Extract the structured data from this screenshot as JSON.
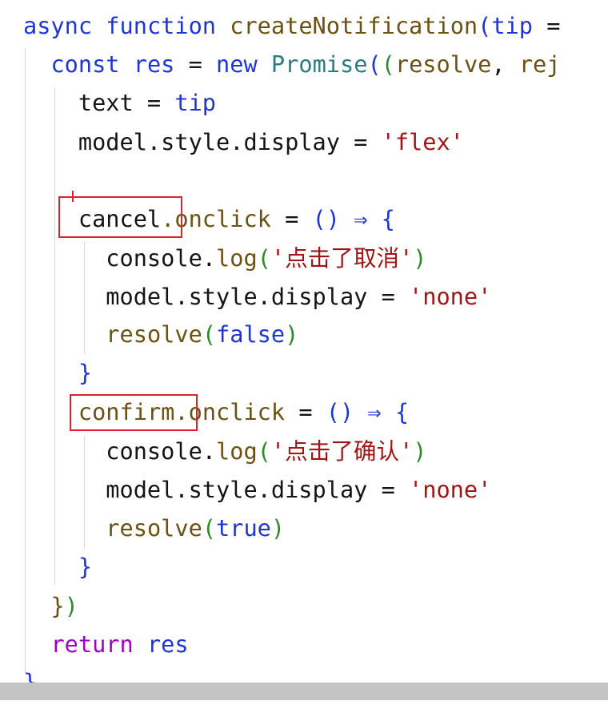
{
  "colors": {
    "keyword": "#1f35d6",
    "control": "#a000c8",
    "function_name": "#6b5213",
    "class_name": "#2b7b80",
    "string": "#a31515",
    "identifier": "#141414",
    "bracket_1": "#1f35d6",
    "bracket_2": "#2b8a2b",
    "bracket_3": "#6b5213",
    "highlight_box": "#e0222b",
    "indent_guide": "#d8d8d8",
    "scrollbar": "#c4c4c4"
  },
  "code_lines": [
    [
      {
        "t": "async",
        "c": "keyword"
      },
      {
        "t": " "
      },
      {
        "t": "function",
        "c": "keyword"
      },
      {
        "t": " "
      },
      {
        "t": "createNotification",
        "c": "function_name"
      },
      {
        "t": "(",
        "c": "bracket_1"
      },
      {
        "t": "tip",
        "c": "keyword"
      },
      {
        "t": " ="
      }
    ],
    [
      {
        "t": "  "
      },
      {
        "t": "const",
        "c": "keyword"
      },
      {
        "t": " "
      },
      {
        "t": "res",
        "c": "keyword"
      },
      {
        "t": " = "
      },
      {
        "t": "new",
        "c": "keyword"
      },
      {
        "t": " "
      },
      {
        "t": "Promise",
        "c": "class_name"
      },
      {
        "t": "(",
        "c": "bracket_1"
      },
      {
        "t": "(",
        "c": "bracket_2"
      },
      {
        "t": "resolve",
        "c": "function_name"
      },
      {
        "t": ", "
      },
      {
        "t": "rej",
        "c": "function_name"
      }
    ],
    [
      {
        "t": "    text = "
      },
      {
        "t": "tip",
        "c": "keyword"
      }
    ],
    [
      {
        "t": "    model.style.display = "
      },
      {
        "t": "'flex'",
        "c": "string"
      }
    ],
    [
      {
        "t": ""
      }
    ],
    [
      {
        "t": "    cancel"
      },
      {
        "t": ".onclick",
        "c": "function_name"
      },
      {
        "t": " = "
      },
      {
        "t": "()",
        "c": "bracket_1"
      },
      {
        "t": " ⇒ ",
        "c": "keyword"
      },
      {
        "t": "{",
        "c": "bracket_1"
      }
    ],
    [
      {
        "t": "      console."
      },
      {
        "t": "log",
        "c": "function_name"
      },
      {
        "t": "(",
        "c": "bracket_2"
      },
      {
        "t": "'点击了取消'",
        "c": "string"
      },
      {
        "t": ")",
        "c": "bracket_2"
      }
    ],
    [
      {
        "t": "      model.style.display = "
      },
      {
        "t": "'none'",
        "c": "string"
      }
    ],
    [
      {
        "t": "      "
      },
      {
        "t": "resolve",
        "c": "function_name"
      },
      {
        "t": "(",
        "c": "bracket_2"
      },
      {
        "t": "false",
        "c": "keyword"
      },
      {
        "t": ")",
        "c": "bracket_2"
      }
    ],
    [
      {
        "t": "    "
      },
      {
        "t": "}",
        "c": "bracket_1"
      }
    ],
    [
      {
        "t": "    "
      },
      {
        "t": "confirm",
        "c": "function_name"
      },
      {
        "t": ".onclick",
        "c": "function_name"
      },
      {
        "t": " = "
      },
      {
        "t": "()",
        "c": "bracket_1"
      },
      {
        "t": " ⇒ ",
        "c": "keyword"
      },
      {
        "t": "{",
        "c": "bracket_1"
      }
    ],
    [
      {
        "t": "      console."
      },
      {
        "t": "log",
        "c": "function_name"
      },
      {
        "t": "(",
        "c": "bracket_2"
      },
      {
        "t": "'点击了确认'",
        "c": "string"
      },
      {
        "t": ")",
        "c": "bracket_2"
      }
    ],
    [
      {
        "t": "      model.style.display = "
      },
      {
        "t": "'none'",
        "c": "string"
      }
    ],
    [
      {
        "t": "      "
      },
      {
        "t": "resolve",
        "c": "function_name"
      },
      {
        "t": "(",
        "c": "bracket_2"
      },
      {
        "t": "true",
        "c": "keyword"
      },
      {
        "t": ")",
        "c": "bracket_2"
      }
    ],
    [
      {
        "t": "    "
      },
      {
        "t": "}",
        "c": "bracket_1"
      }
    ],
    [
      {
        "t": "  "
      },
      {
        "t": "}",
        "c": "bracket_3"
      },
      {
        "t": ")",
        "c": "bracket_2"
      }
    ],
    [
      {
        "t": "  "
      },
      {
        "t": "return",
        "c": "control"
      },
      {
        "t": " "
      },
      {
        "t": "res",
        "c": "keyword"
      }
    ],
    [
      {
        "t": "}",
        "c": "bracket_1"
      }
    ]
  ]
}
